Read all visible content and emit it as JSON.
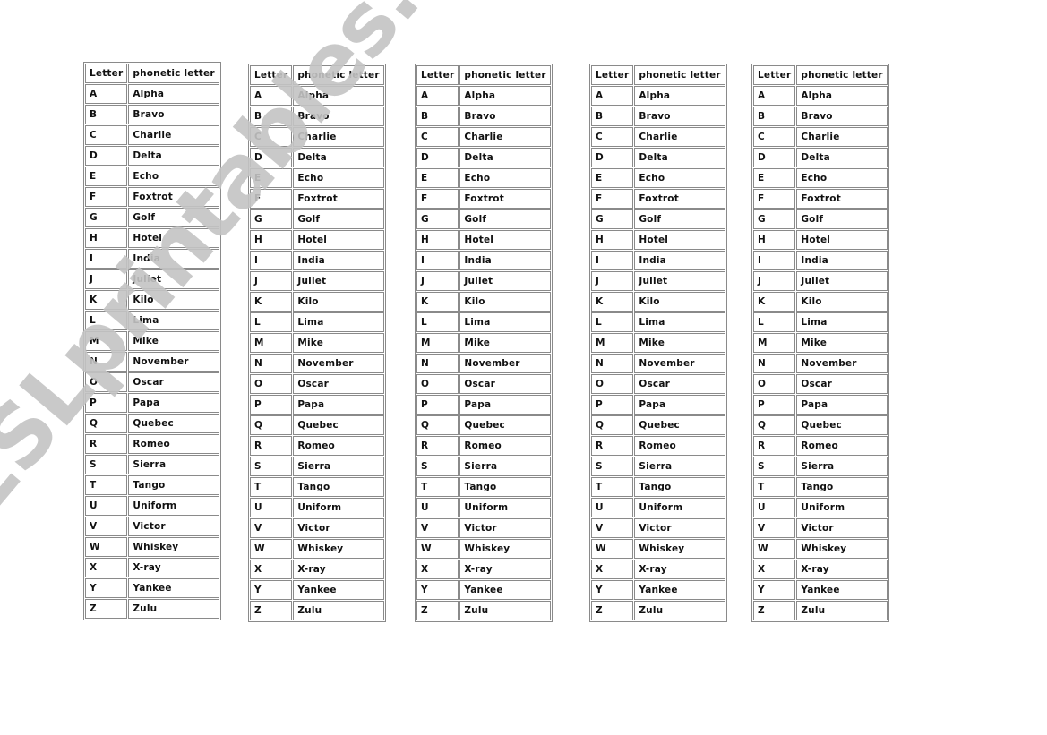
{
  "headers": {
    "letter": "Letter",
    "phonetic": "phonetic letter"
  },
  "alphabet": [
    {
      "letter": "A",
      "word": "Alpha"
    },
    {
      "letter": "B",
      "word": "Bravo"
    },
    {
      "letter": "C",
      "word": "Charlie"
    },
    {
      "letter": "D",
      "word": "Delta"
    },
    {
      "letter": "E",
      "word": "Echo"
    },
    {
      "letter": "F",
      "word": "Foxtrot"
    },
    {
      "letter": "G",
      "word": "Golf"
    },
    {
      "letter": "H",
      "word": "Hotel"
    },
    {
      "letter": "I",
      "word": "India"
    },
    {
      "letter": "J",
      "word": "Juliet"
    },
    {
      "letter": "K",
      "word": "Kilo"
    },
    {
      "letter": "L",
      "word": "Lima"
    },
    {
      "letter": "M",
      "word": "Mike"
    },
    {
      "letter": "N",
      "word": "November"
    },
    {
      "letter": "O",
      "word": "Oscar"
    },
    {
      "letter": "P",
      "word": "Papa"
    },
    {
      "letter": "Q",
      "word": "Quebec"
    },
    {
      "letter": "R",
      "word": "Romeo"
    },
    {
      "letter": "S",
      "word": "Sierra"
    },
    {
      "letter": "T",
      "word": "Tango"
    },
    {
      "letter": "U",
      "word": "Uniform"
    },
    {
      "letter": "V",
      "word": "Victor"
    },
    {
      "letter": "W",
      "word": "Whiskey"
    },
    {
      "letter": "X",
      "word": "X-ray"
    },
    {
      "letter": "Y",
      "word": "Yankee"
    },
    {
      "letter": "Z",
      "word": "Zulu"
    }
  ],
  "table_count": 5,
  "watermark": "ESLprintables.com"
}
